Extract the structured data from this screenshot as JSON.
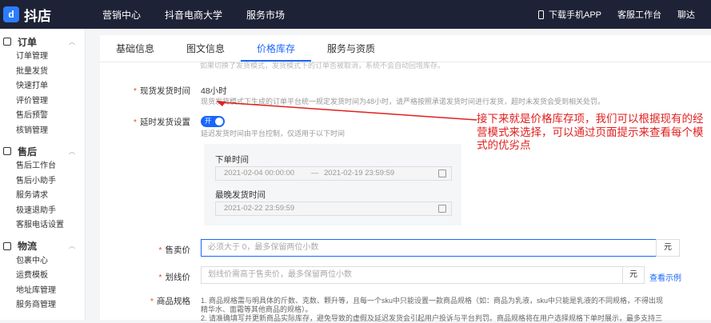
{
  "topbar": {
    "logo": "抖店",
    "logo_mark": "d",
    "nav": [
      "营销中心",
      "抖音电商大学",
      "服务市场"
    ],
    "download": "下载手机APP",
    "workbench": "客服工作台",
    "right": "聊达"
  },
  "sidebar": {
    "groups": [
      {
        "title": "订单",
        "icon": "order-icon",
        "items": [
          "订单管理",
          "批量发货",
          "快速打单",
          "评价管理",
          "售后预警",
          "核销管理"
        ]
      },
      {
        "title": "售后",
        "icon": "aftersale-icon",
        "items": [
          "售后工作台",
          "售后小助手",
          "服务请求",
          "极速退助手",
          "客服电话设置"
        ]
      },
      {
        "title": "物流",
        "icon": "logistics-icon",
        "items": [
          "包裹中心",
          "运费模板",
          "地址库管理",
          "服务商管理"
        ]
      }
    ]
  },
  "tabs": [
    "基础信息",
    "图文信息",
    "价格库存",
    "服务与资质"
  ],
  "active_tab": "价格库存",
  "form": {
    "top_faded": "如果切换了发货模式，发货模式下的订单否被取消，系统不会自动回增库存。",
    "ship_time_label": "现货发货时间",
    "ship_time_value": "48小时",
    "ship_time_hint": "现货发货模式下生成的订单平台统一规定发货时间为48小时，请严格按照承诺发货时间进行发货，超时未发货会受到相关处罚。",
    "delay_label": "延时发货设置",
    "switch_text": "开",
    "delay_hint": "延迟发货时间由平台控制，仅适用于以下时间",
    "order_time_label": "下单时间",
    "order_time_start": "2021-02-04 00:00:00",
    "order_time_sep": "—",
    "order_time_end": "2021-02-19 23:59:59",
    "latest_label": "最晚发货时间",
    "latest_value": "2021-02-22 23:59:59",
    "price_label": "售卖价",
    "price_placeholder": "必须大于 0，最多保留两位小数",
    "unit": "元",
    "strike_label": "划线价",
    "strike_placeholder": "划线价需高于售卖价，最多保留两位小数",
    "view_example": "查看示例",
    "spec_label": "商品规格",
    "spec_rule1": "1. 商品规格需与明具体的斤数、克数、颗升等，且每一个sku中只能设置一款商品规格（如：商品为乳液，sku中只能是乳液的不同规格，不得出现",
    "spec_rule1b": "精华水、面霜等其他商品的规格）。",
    "spec_rule2": "2. 请准确填写并更新商品实际库存，避免导致的虚假及延迟发货会引起用户投诉与平台判罚。商品规格将在用户选择规格下单时展示，最多支持三"
  },
  "annotation": "接下来就是价格库存项，我们可以根据现有的经营模式来选择，可以通过页面提示来查看每个模式的优劣点",
  "colors": {
    "accent": "#1966ff",
    "annotation": "#e02020",
    "required": "#f24724"
  }
}
